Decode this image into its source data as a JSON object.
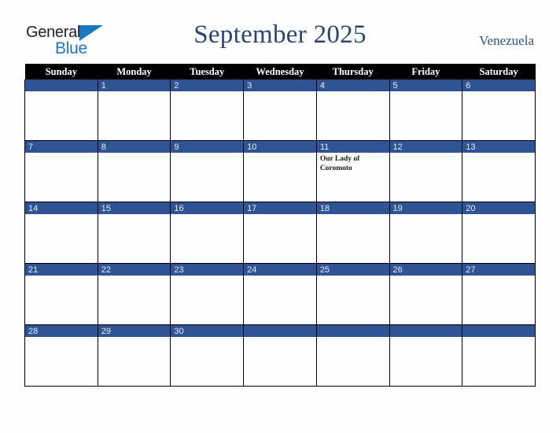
{
  "brand": {
    "name_part1": "General",
    "name_part2": "Blue",
    "triangle_icon": "triangle-icon",
    "blue_hex": "#1878be",
    "dark_hex": "#231f20"
  },
  "header": {
    "title": "September 2025",
    "country": "Venezuela",
    "title_color": "#2b4570"
  },
  "calendar": {
    "accent_hex": "#2f5496",
    "header_bg_hex": "#000000",
    "weekdays": [
      "Sunday",
      "Monday",
      "Tuesday",
      "Wednesday",
      "Thursday",
      "Friday",
      "Saturday"
    ],
    "weeks": [
      [
        {
          "day": "",
          "event": ""
        },
        {
          "day": "1",
          "event": ""
        },
        {
          "day": "2",
          "event": ""
        },
        {
          "day": "3",
          "event": ""
        },
        {
          "day": "4",
          "event": ""
        },
        {
          "day": "5",
          "event": ""
        },
        {
          "day": "6",
          "event": ""
        }
      ],
      [
        {
          "day": "7",
          "event": ""
        },
        {
          "day": "8",
          "event": ""
        },
        {
          "day": "9",
          "event": ""
        },
        {
          "day": "10",
          "event": ""
        },
        {
          "day": "11",
          "event": "Our Lady of Coromoto"
        },
        {
          "day": "12",
          "event": ""
        },
        {
          "day": "13",
          "event": ""
        }
      ],
      [
        {
          "day": "14",
          "event": ""
        },
        {
          "day": "15",
          "event": ""
        },
        {
          "day": "16",
          "event": ""
        },
        {
          "day": "17",
          "event": ""
        },
        {
          "day": "18",
          "event": ""
        },
        {
          "day": "19",
          "event": ""
        },
        {
          "day": "20",
          "event": ""
        }
      ],
      [
        {
          "day": "21",
          "event": ""
        },
        {
          "day": "22",
          "event": ""
        },
        {
          "day": "23",
          "event": ""
        },
        {
          "day": "24",
          "event": ""
        },
        {
          "day": "25",
          "event": ""
        },
        {
          "day": "26",
          "event": ""
        },
        {
          "day": "27",
          "event": ""
        }
      ],
      [
        {
          "day": "28",
          "event": ""
        },
        {
          "day": "29",
          "event": ""
        },
        {
          "day": "30",
          "event": ""
        },
        {
          "day": "",
          "event": ""
        },
        {
          "day": "",
          "event": ""
        },
        {
          "day": "",
          "event": ""
        },
        {
          "day": "",
          "event": ""
        }
      ]
    ]
  }
}
